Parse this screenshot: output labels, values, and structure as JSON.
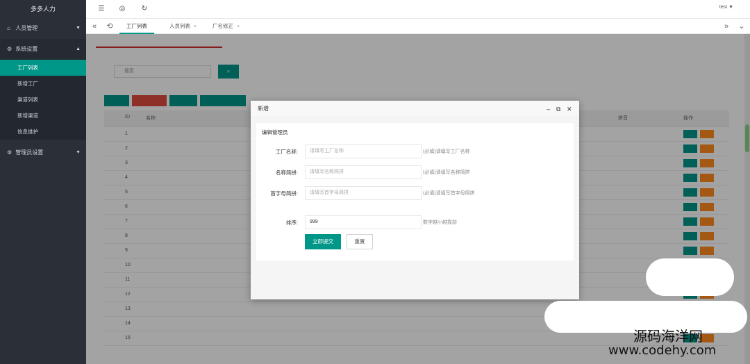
{
  "app": {
    "title": "多多人力"
  },
  "sidebar": {
    "groups": [
      {
        "label": "人员管理",
        "icon": "home-icon",
        "caret": "▼"
      },
      {
        "label": "系统设置",
        "icon": "gear-icon",
        "caret": "▲"
      },
      {
        "label": "管理员设置",
        "icon": "gear-icon",
        "caret": "▼"
      }
    ],
    "items": [
      "工厂列表",
      "新增工厂",
      "渠道列表",
      "新增渠道",
      "信息维护"
    ]
  },
  "header": {
    "icons": [
      "menu-fold-icon",
      "target-icon",
      "refresh-icon"
    ],
    "user": "test"
  },
  "tabs": {
    "items": [
      {
        "label": "工厂列表",
        "active": true
      },
      {
        "label": "人员列表",
        "active": false
      },
      {
        "label": "厂名修正",
        "active": false
      }
    ],
    "close_glyph": "×"
  },
  "main": {
    "search_placeholder": "搜索",
    "table": {
      "columns": [
        "ID",
        "名称",
        "拼音",
        "操作"
      ],
      "rows": [
        {
          "id": "1"
        },
        {
          "id": "2"
        },
        {
          "id": "3"
        },
        {
          "id": "4"
        },
        {
          "id": "5"
        },
        {
          "id": "6"
        },
        {
          "id": "7"
        },
        {
          "id": "8"
        },
        {
          "id": "9"
        },
        {
          "id": "10"
        },
        {
          "id": "11"
        },
        {
          "id": "12"
        },
        {
          "id": "13"
        },
        {
          "id": "14"
        },
        {
          "id": "15"
        }
      ]
    }
  },
  "dialog": {
    "title": "新增",
    "section_head": "编辑管理员",
    "fields": [
      {
        "label": "工厂名称:",
        "placeholder": "请填写工厂名称",
        "hint": "(必填)请填写工厂名称"
      },
      {
        "label": "名称简拼:",
        "placeholder": "请填写名称简拼",
        "hint": "(必填)请填写名称简拼"
      },
      {
        "label": "首字母简拼:",
        "placeholder": "请填写首字母简拼",
        "hint": "(必填)请填写首字母简拼"
      },
      {
        "label": "排序:",
        "value": "999",
        "hint": "数字越小越靠前"
      }
    ],
    "submit_label": "立即提交",
    "reset_label": "重置"
  },
  "watermark": {
    "text_cn": "源码海洋网",
    "text_url": "www.codehy.com"
  },
  "colors": {
    "sidebar_bg": "#2a2f38",
    "accent": "#009688",
    "danger": "#e04b3f",
    "warning": "#ff8a1e"
  }
}
